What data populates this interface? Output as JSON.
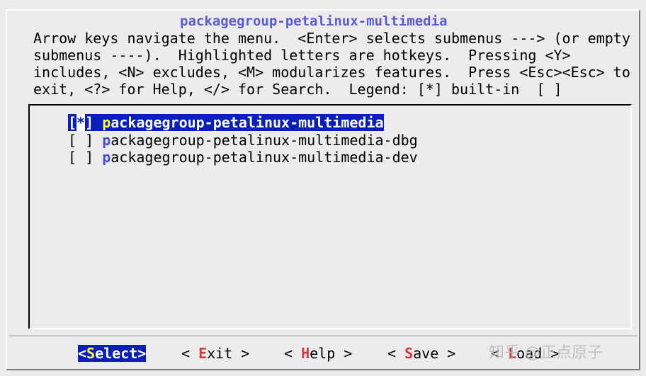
{
  "dialog": {
    "title": "packagegroup-petalinux-multimedia",
    "help_text": "Arrow keys navigate the menu.  <Enter> selects submenus ---> (or empty\nsubmenus ----).  Highlighted letters are hotkeys.  Pressing <Y>\nincludes, <N> excludes, <M> modularizes features.  Press <Esc><Esc> to\nexit, <?> for Help, </> for Search.  Legend: [*] built-in  [ ]"
  },
  "menu": {
    "items": [
      {
        "open": "[",
        "state": "*",
        "close": "] ",
        "hotkey": "p",
        "rest": "ackagegroup-petalinux-multimedia",
        "selected": true
      },
      {
        "open": "[",
        "state": " ",
        "close": "] ",
        "hotkey": "p",
        "rest": "ackagegroup-petalinux-multimedia-dbg",
        "selected": false
      },
      {
        "open": "[",
        "state": " ",
        "close": "] ",
        "hotkey": "p",
        "rest": "ackagegroup-petalinux-multimedia-dev",
        "selected": false
      }
    ]
  },
  "buttons": {
    "select": {
      "pre": "<",
      "hotkey": "S",
      "rest": "elect>"
    },
    "exit": {
      "pre": "< ",
      "hotkey": "E",
      "rest": "xit >"
    },
    "help": {
      "pre": "< ",
      "hotkey": "H",
      "rest": "elp >"
    },
    "save": {
      "pre": "< ",
      "hotkey": "S",
      "rest": "ave >"
    },
    "load": {
      "pre": "< ",
      "hotkey": "L",
      "rest": "oad >"
    }
  },
  "watermark": "知乎 @正点原子",
  "colors": {
    "background": "#ececec",
    "selection": "#0a1fb8",
    "hotkey_menu": "#4a4ae0",
    "hotkey_button": "#d03a3a",
    "title": "#5b5bd6"
  }
}
